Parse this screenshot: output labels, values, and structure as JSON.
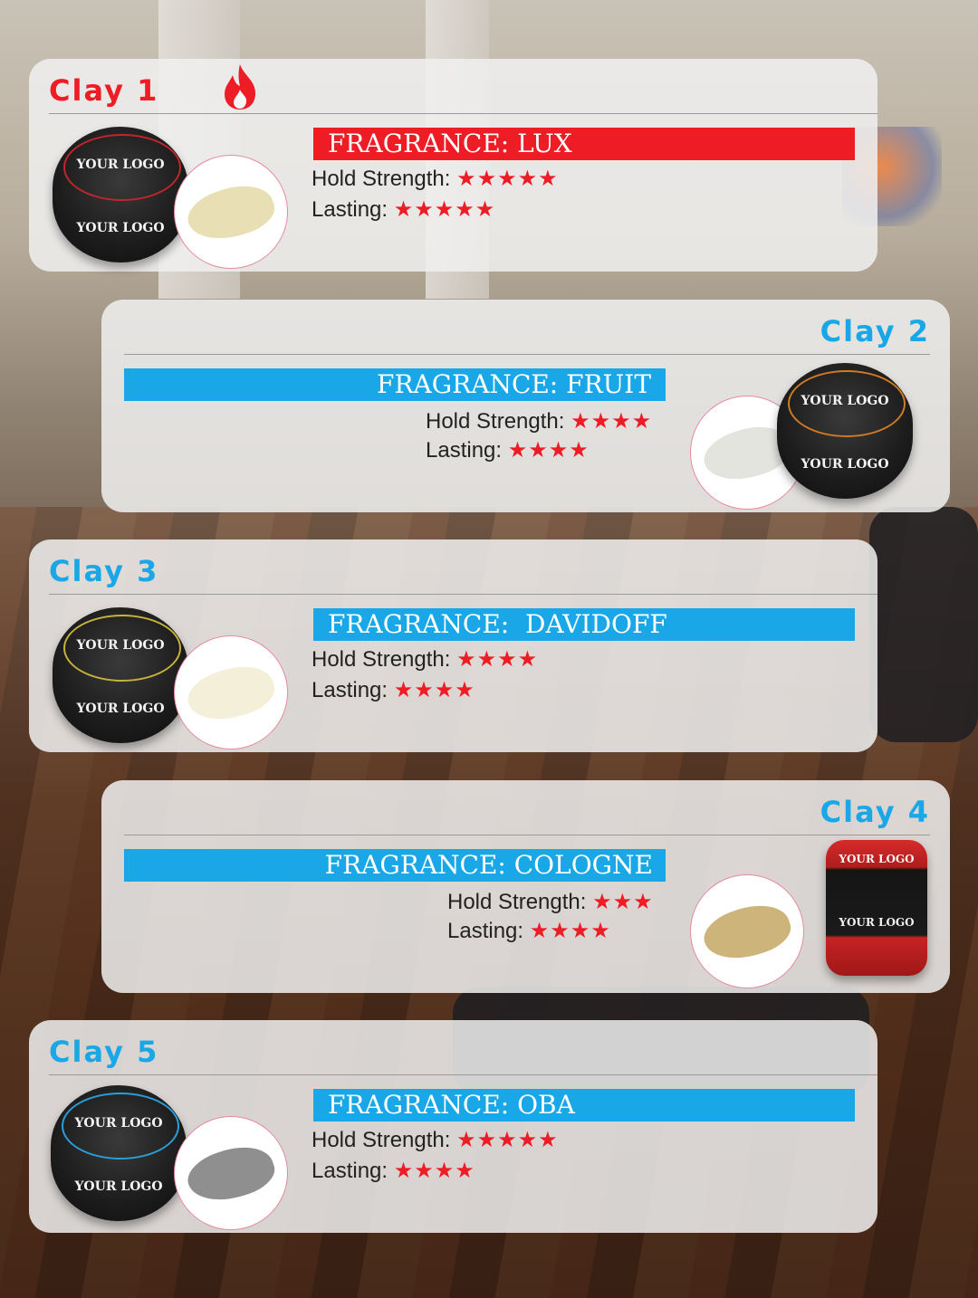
{
  "colors": {
    "red": "#ee1c25",
    "blue": "#1aa7e8",
    "star": "#ee1c25"
  },
  "jar_logo_text": "YOUR LOGO",
  "cards": [
    {
      "title": "Clay 1",
      "fragrance": "FRAGRANCE: LUX",
      "hold_label": "Hold Strength: ",
      "hold_stars": "★★★★★",
      "lasting_label": "Lasting: ",
      "lasting_stars": "★★★★★",
      "accent": "red",
      "icon": "flame-icon"
    },
    {
      "title": "Clay 2",
      "fragrance": "FRAGRANCE: FRUIT",
      "hold_label": "Hold Strength: ",
      "hold_stars": "★★★★",
      "lasting_label": "Lasting: ",
      "lasting_stars": "★★★★",
      "accent": "blue"
    },
    {
      "title": "Clay 3",
      "fragrance": "FRAGRANCE:  DAVIDOFF",
      "hold_label": "Hold Strength: ",
      "hold_stars": "★★★★",
      "lasting_label": "Lasting: ",
      "lasting_stars": "★★★★",
      "accent": "blue"
    },
    {
      "title": "Clay 4",
      "fragrance": "FRAGRANCE: COLOGNE",
      "hold_label": "Hold Strength: ",
      "hold_stars": "★★★",
      "lasting_label": "Lasting: ",
      "lasting_stars": "★★★★",
      "accent": "blue"
    },
    {
      "title": "Clay 5",
      "fragrance": "FRAGRANCE: OBA",
      "hold_label": "Hold Strength: ",
      "hold_stars": "★★★★★",
      "lasting_label": "Lasting: ",
      "lasting_stars": "★★★★",
      "accent": "blue"
    }
  ]
}
